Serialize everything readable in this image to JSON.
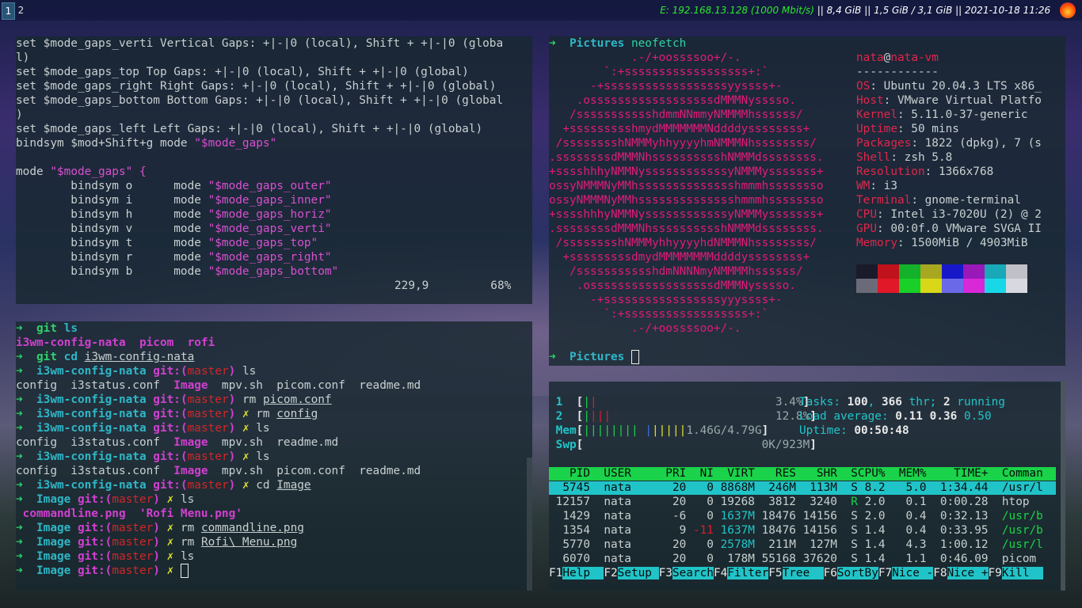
{
  "bar": {
    "workspaces": [
      "1",
      "2"
    ],
    "net": "E: 192.168.13.128 (1000 Mbit/s)",
    "disk": " || 8,4 GiB ",
    "mem": "|| 1,5 GiB / 3,1 GiB ",
    "date": "|| 2021-10-18 11:26 "
  },
  "vim": {
    "lines": [
      "set $mode_gaps_verti Vertical Gaps: +|-|0 (local), Shift + +|-|0 (globa",
      "l)",
      "set $mode_gaps_top Top Gaps: +|-|0 (local), Shift + +|-|0 (global)",
      "set $mode_gaps_right Right Gaps: +|-|0 (local), Shift + +|-|0 (global)",
      "set $mode_gaps_bottom Bottom Gaps: +|-|0 (local), Shift + +|-|0 (global",
      ")",
      "set $mode_gaps_left Left Gaps: +|-|0 (local), Shift + +|-|0 (global)",
      "bindsym $mod+Shift+g mode ",
      "",
      "mode "
    ],
    "bindsym_str": "\"$mode_gaps\"",
    "mode_str": "\"$mode_gaps\" {",
    "binds": [
      {
        "key": "        bindsym o      mode ",
        "target": "\"$mode_gaps_outer\""
      },
      {
        "key": "        bindsym i      mode ",
        "target": "\"$mode_gaps_inner\""
      },
      {
        "key": "        bindsym h      mode ",
        "target": "\"$mode_gaps_horiz\""
      },
      {
        "key": "        bindsym v      mode ",
        "target": "\"$mode_gaps_verti\""
      },
      {
        "key": "        bindsym t      mode ",
        "target": "\"$mode_gaps_top\""
      },
      {
        "key": "        bindsym r      mode ",
        "target": "\"$mode_gaps_right\""
      },
      {
        "key": "        bindsym b      mode ",
        "target": "\"$mode_gaps_bottom\""
      }
    ],
    "ruler": "229,9         68%"
  },
  "shell": {
    "arrow": "➜",
    "lines": [
      {
        "parts": [
          [
            "g",
            "➜  "
          ],
          [
            "g",
            "git"
          ],
          [
            "c",
            " ls"
          ]
        ]
      },
      {
        "parts": [
          [
            "m",
            "i3wm-config-nata  picom  rofi"
          ]
        ]
      },
      {
        "parts": [
          [
            "g",
            "➜  "
          ],
          [
            "g",
            "git"
          ],
          [
            "c",
            " cd "
          ],
          [
            "u",
            "i3wm-config-nata"
          ]
        ]
      },
      {
        "parts": [
          [
            "g",
            "➜  "
          ],
          [
            "c",
            "i3wm-config-nata "
          ],
          [
            "m",
            "git:("
          ],
          [
            "r",
            "master"
          ],
          [
            "m",
            ")"
          ],
          [
            "n",
            " ls"
          ]
        ]
      },
      {
        "parts": [
          [
            "n",
            "config  i3status.conf  "
          ],
          [
            "m",
            "Image"
          ],
          [
            "n",
            "  mpv.sh  picom.conf  readme.md"
          ]
        ]
      },
      {
        "parts": [
          [
            "g",
            "➜  "
          ],
          [
            "c",
            "i3wm-config-nata "
          ],
          [
            "m",
            "git:("
          ],
          [
            "r",
            "master"
          ],
          [
            "m",
            ")"
          ],
          [
            "n",
            " rm "
          ],
          [
            "u",
            "picom.conf"
          ]
        ]
      },
      {
        "parts": [
          [
            "g",
            "➜  "
          ],
          [
            "c",
            "i3wm-config-nata "
          ],
          [
            "m",
            "git:("
          ],
          [
            "r",
            "master"
          ],
          [
            "m",
            ")"
          ],
          [
            "y",
            " ✗"
          ],
          [
            "n",
            " rm "
          ],
          [
            "u",
            "config"
          ]
        ]
      },
      {
        "parts": [
          [
            "g",
            "➜  "
          ],
          [
            "c",
            "i3wm-config-nata "
          ],
          [
            "m",
            "git:("
          ],
          [
            "r",
            "master"
          ],
          [
            "m",
            ")"
          ],
          [
            "y",
            " ✗"
          ],
          [
            "n",
            " ls"
          ]
        ]
      },
      {
        "parts": [
          [
            "n",
            "config  i3status.conf  "
          ],
          [
            "m",
            "Image"
          ],
          [
            "n",
            "  mpv.sh  readme.md"
          ]
        ]
      },
      {
        "parts": [
          [
            "g",
            "➜  "
          ],
          [
            "c",
            "i3wm-config-nata "
          ],
          [
            "m",
            "git:("
          ],
          [
            "r",
            "master"
          ],
          [
            "m",
            ")"
          ],
          [
            "y",
            " ✗"
          ],
          [
            "n",
            " ls"
          ]
        ]
      },
      {
        "parts": [
          [
            "n",
            "config  i3status.conf  "
          ],
          [
            "m",
            "Image"
          ],
          [
            "n",
            "  mpv.sh  picom.conf  readme.md"
          ]
        ]
      },
      {
        "parts": [
          [
            "g",
            "➜  "
          ],
          [
            "c",
            "i3wm-config-nata "
          ],
          [
            "m",
            "git:("
          ],
          [
            "r",
            "master"
          ],
          [
            "m",
            ")"
          ],
          [
            "y",
            " ✗"
          ],
          [
            "n",
            " cd "
          ],
          [
            "u",
            "Image"
          ]
        ]
      },
      {
        "parts": [
          [
            "g",
            "➜  "
          ],
          [
            "c",
            "Image "
          ],
          [
            "m",
            "git:("
          ],
          [
            "r",
            "master"
          ],
          [
            "m",
            ")"
          ],
          [
            "y",
            " ✗"
          ],
          [
            "n",
            " ls"
          ]
        ]
      },
      {
        "parts": [
          [
            "m",
            " commandline.png  'Rofi Menu.png'"
          ]
        ]
      },
      {
        "parts": [
          [
            "g",
            "➜  "
          ],
          [
            "c",
            "Image "
          ],
          [
            "m",
            "git:("
          ],
          [
            "r",
            "master"
          ],
          [
            "m",
            ")"
          ],
          [
            "y",
            " ✗"
          ],
          [
            "n",
            " rm "
          ],
          [
            "u",
            "commandline.png"
          ]
        ]
      },
      {
        "parts": [
          [
            "g",
            "➜  "
          ],
          [
            "c",
            "Image "
          ],
          [
            "m",
            "git:("
          ],
          [
            "r",
            "master"
          ],
          [
            "m",
            ")"
          ],
          [
            "y",
            " ✗"
          ],
          [
            "n",
            " rm "
          ],
          [
            "u",
            "Rofi\\ Menu.png"
          ]
        ]
      },
      {
        "parts": [
          [
            "g",
            "➜  "
          ],
          [
            "c",
            "Image "
          ],
          [
            "m",
            "git:("
          ],
          [
            "r",
            "master"
          ],
          [
            "m",
            ")"
          ],
          [
            "y",
            " ✗"
          ],
          [
            "n",
            " ls"
          ]
        ]
      },
      {
        "parts": [
          [
            "g",
            "➜  "
          ],
          [
            "c",
            "Image "
          ],
          [
            "m",
            "git:("
          ],
          [
            "r",
            "master"
          ],
          [
            "m",
            ")"
          ],
          [
            "y",
            " ✗ "
          ],
          [
            "cur",
            ""
          ]
        ]
      }
    ]
  },
  "neofetch": {
    "prompt_dir": "Pictures",
    "prompt_cmd": " neofetch",
    "art": [
      "            .-/+oossssoo+/-.",
      "        `:+ssssssssssssssssss+:`",
      "      -+ssssssssssssssssssyyssss+-",
      "    .ossssssssssssssssssdMMMNysssso.",
      "   /ssssssssssshdmmNNmmyNMMMMhssssss/",
      "  +ssssssssshmydMMMMMMMNddddyssssssss+",
      " /sssssssshNMMMyhhyyyyhmNMMMNhssssssss/",
      ".ssssssssdMMMNhsssssssssshNMMMdssssssss.",
      "+sssshhhyNMMNyssssssssssssyNMMMysssssss+",
      "ossyNMMMNyMMhsssssssssssssshmmmhssssssso",
      "ossyNMMMNyMMhsssssssssssssshmmmhssssssso",
      "+sssshhhyNMMNyssssssssssssyNMMMysssssss+",
      ".ssssssssdMMMNhsssssssssshNMMMdssssssss.",
      " /sssssssshNMMMyhhyyyyhdNMMMNhssssssss/",
      "  +sssssssssdmydMMMMMMMMddddyssssssss+",
      "   /ssssssssssshdmNNNNmyNMMMMhssssss/",
      "    .ossssssssssssssssssdMMMNysssso.",
      "      -+sssssssssssssssssyyyssss+-",
      "        `:+ssssssssssssssssss+:`",
      "            .-/+oossssoo+/-."
    ],
    "user": "nata",
    "at": "@",
    "host": "nata-vm",
    "sep": "------------",
    "info": [
      {
        "k": "OS",
        "v": ": Ubuntu 20.04.3 LTS x86_"
      },
      {
        "k": "Host",
        "v": ": VMware Virtual Platfo"
      },
      {
        "k": "Kernel",
        "v": ": 5.11.0-37-generic"
      },
      {
        "k": "Uptime",
        "v": ": 50 mins"
      },
      {
        "k": "Packages",
        "v": ": 1822 (dpkg), 7 (s"
      },
      {
        "k": "Shell",
        "v": ": zsh 5.8"
      },
      {
        "k": "Resolution",
        "v": ": 1366x768"
      },
      {
        "k": "WM",
        "v": ": i3"
      },
      {
        "k": "Terminal",
        "v": ": gnome-terminal"
      },
      {
        "k": "CPU",
        "v": ": Intel i3-7020U (2) @ 2"
      },
      {
        "k": "GPU",
        "v": ": 00:0f.0 VMware SVGA II"
      },
      {
        "k": "Memory",
        "v": ": 1500MiB / 4903MiB"
      }
    ],
    "palette_top": [
      "#171421",
      "#c01c28",
      "#26a269",
      "#a2734c",
      "#12488b",
      "#a347ba",
      "#2aa1b3",
      "#d0cfcc"
    ],
    "palette_bottom": [
      "#5e5c64",
      "#f66151",
      "#33d17a",
      "#e9ad0c",
      "#2a7bde",
      "#c061cb",
      "#33c7de",
      "#ffffff"
    ],
    "palette_top_actual": [
      "#1a1a2a",
      "#c0121c",
      "#13b22a",
      "#a8a820",
      "#1818c8",
      "#9818b8",
      "#18a8b8",
      "#c0c0c8"
    ],
    "palette_bottom_actual": [
      "#6a6a78",
      "#e01828",
      "#18d028",
      "#d8d818",
      "#6a6ae8",
      "#d828d8",
      "#18d8e8",
      "#d8d8e0"
    ],
    "prompt2_dir": "Pictures"
  },
  "htop": {
    "cpu1_label": "1",
    "cpu1_pct": "3.4%",
    "cpu2_label": "2",
    "cpu2_pct": "12.8%",
    "mem_label": "Mem",
    "mem_val": "1.46G/4.79G",
    "swp_label": "Swp",
    "swp_val": "0K/923M",
    "tasks_label": "Tasks: ",
    "tasks": "100",
    "thr": "366",
    "running": "2",
    "load_label": "Load average: ",
    "load1": "0.11",
    "load5": "0.36",
    "load15": "0.50",
    "uptime_label": "Uptime: ",
    "uptime": "00:50:48",
    "header": [
      "PID",
      "USER",
      "PRI",
      "NI",
      "VIRT",
      "RES",
      "SHR",
      "S",
      "CPU%",
      "MEM%",
      "TIME+",
      "Comman"
    ],
    "rows": [
      [
        "5745",
        "nata",
        "20",
        "0",
        "8868M",
        "246M",
        "113M",
        "S",
        "8.2",
        "5.0",
        "1:34.44",
        "/usr/l"
      ],
      [
        "12157",
        "nata",
        "20",
        "0",
        "19268",
        "3812",
        "3240",
        "R",
        "2.0",
        "0.1",
        "0:00.28",
        "htop"
      ],
      [
        "1429",
        "nata",
        "-6",
        "0",
        "1637M",
        "18476",
        "14156",
        "S",
        "2.0",
        "0.4",
        "0:32.13",
        "/usr/b"
      ],
      [
        "1354",
        "nata",
        "9",
        "-11",
        "1637M",
        "18476",
        "14156",
        "S",
        "1.4",
        "0.4",
        "0:33.95",
        "/usr/b"
      ],
      [
        "5770",
        "nata",
        "20",
        "0",
        "2578M",
        "211M",
        "127M",
        "S",
        "1.4",
        "4.3",
        "1:00.12",
        "/usr/l"
      ],
      [
        "6070",
        "nata",
        "20",
        "0",
        "178M",
        "55168",
        "37620",
        "S",
        "1.4",
        "1.1",
        "0:46.09",
        "picom"
      ]
    ],
    "fkeys": [
      {
        "k": "F1",
        "l": "Help  "
      },
      {
        "k": "F2",
        "l": "Setup "
      },
      {
        "k": "F3",
        "l": "Search"
      },
      {
        "k": "F4",
        "l": "Filter"
      },
      {
        "k": "F5",
        "l": "Tree  "
      },
      {
        "k": "F6",
        "l": "SortBy"
      },
      {
        "k": "F7",
        "l": "Nice -"
      },
      {
        "k": "F8",
        "l": "Nice +"
      },
      {
        "k": "F9",
        "l": "Kill  "
      }
    ]
  }
}
